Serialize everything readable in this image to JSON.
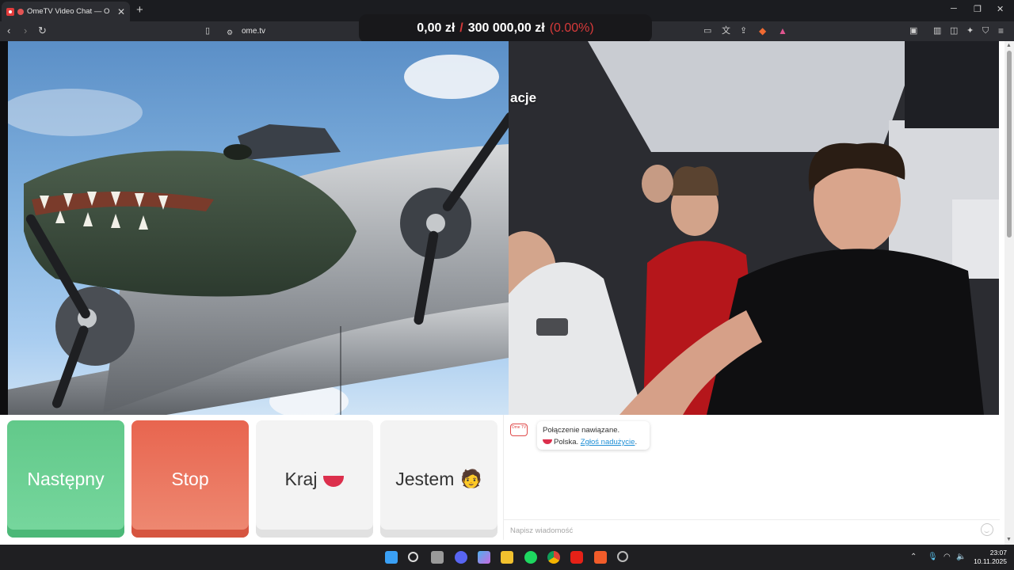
{
  "browser": {
    "tab_title": "OmeTV Video Chat — Omeg",
    "url": "ome.tv",
    "new_tab": "+",
    "close_tab": "✕"
  },
  "overlay": {
    "current": "0,00 zł",
    "separator": "/",
    "goal": "300 000,00 zł",
    "percent": "(0.00%)"
  },
  "stream": {
    "partial_label": "acje"
  },
  "controls": {
    "next": "Następny",
    "stop": "Stop",
    "country": "Kraj",
    "gender": "Jestem"
  },
  "chat": {
    "logo_text": "Ome TV",
    "status": "Połączenie nawiązane.",
    "country": "Polska.",
    "report": "Zgłoś nadużycie",
    "report_suffix": ".",
    "placeholder": "Napisz wiadomość"
  },
  "taskbar": {
    "time": "23:07",
    "date": "10.11.2025"
  },
  "colors": {
    "next_button": "#62c98a",
    "stop_button": "#e8654f",
    "overlay_accent": "#d73a3a",
    "link": "#1f8fd6"
  }
}
